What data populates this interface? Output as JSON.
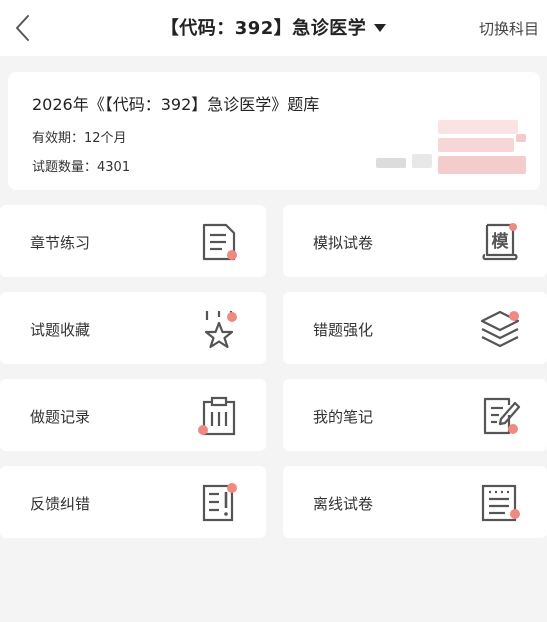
{
  "header": {
    "title": "【代码：392】急诊医学",
    "switch_label": "切换科目"
  },
  "info_card": {
    "title": "2026年《【代码：392】急诊医学》题库",
    "validity": "有效期：12个月",
    "question_count": "试题数量：4301"
  },
  "menu": {
    "chapter_practice": "章节练习",
    "mock_exam": "模拟试卷",
    "mock_exam_icon_glyph": "模",
    "favorites": "试题收藏",
    "mistakes": "错题强化",
    "history": "做题记录",
    "notes": "我的笔记",
    "feedback": "反馈纠错",
    "offline": "离线试卷"
  },
  "colors": {
    "accent_dot": "#f08a80",
    "icon_stroke": "#555555"
  }
}
